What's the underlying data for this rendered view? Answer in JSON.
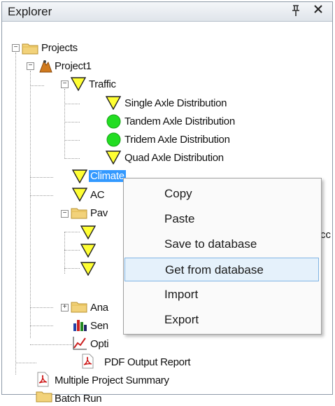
{
  "panel": {
    "title": "Explorer",
    "pin_glyph": "(",
    "close_glyph": "×"
  },
  "tree": {
    "projects": "Projects",
    "project1": "Project1",
    "traffic": "Traffic",
    "single_axle": "Single Axle Distribution",
    "tandem_axle": "Tandem Axle Distribution",
    "tridem_axle": "Tridem Axle Distribution",
    "quad_axle": "Quad Axle Distribution",
    "climate": "Climate",
    "ac": "AC",
    "pav": "Pav",
    "ana": "Ana",
    "sen": "Sen",
    "opti": "Opti",
    "pdf_report": "PDF Output Report",
    "multi_summary": "Multiple Project Summary",
    "batch_run": "Batch Run",
    "cut_text": "cc"
  },
  "context_menu": {
    "items": [
      "Copy",
      "Paste",
      "Save to database",
      "Get from database",
      "Import",
      "Export"
    ],
    "highlighted_index": 3
  },
  "colors": {
    "selection": "#3399ff",
    "warning_triangle": "#ffff33",
    "ok_circle": "#22dd22",
    "folder": "#f2d27a"
  }
}
